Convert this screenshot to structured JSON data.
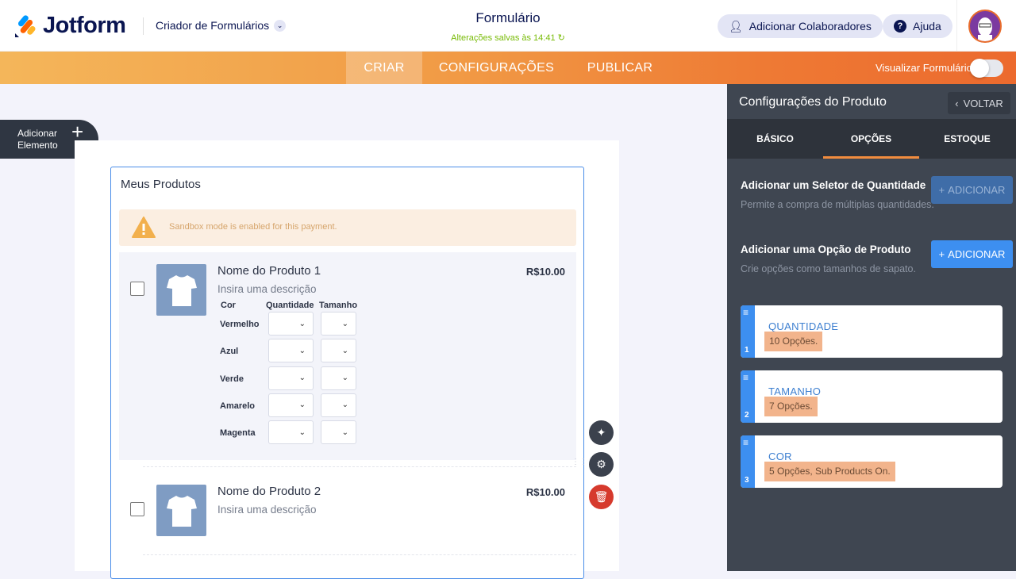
{
  "header": {
    "brand": "Jotform",
    "builder": "Criador de Formulários",
    "title": "Formulário",
    "saved": "Alterações salvas às 14:41",
    "collab": "Adicionar Colaboradores",
    "help": "Ajuda"
  },
  "nav": {
    "tabs": [
      "CRIAR",
      "CONFIGURAÇÕES",
      "PUBLICAR"
    ],
    "active": "CRIAR",
    "preview": "Visualizar Formulário",
    "preview_on": false
  },
  "canvas": {
    "add_element": [
      "Adicionar",
      "Elemento"
    ]
  },
  "widget": {
    "title": "Meus Produtos",
    "warning": "Sandbox mode is enabled for this payment.",
    "products": [
      {
        "name": "Nome do Produto 1",
        "description": "Insira uma descrição",
        "price": "R$10.00"
      },
      {
        "name": "Nome do Produto 2",
        "description": "Insira uma descrição",
        "price": "R$10.00"
      }
    ],
    "columns": [
      "Cor",
      "Quantidade",
      "Tamanho"
    ],
    "colors": [
      "Vermelho",
      "Azul",
      "Verde",
      "Amarelo",
      "Magenta"
    ]
  },
  "panel": {
    "title": "Configurações do Produto",
    "back": "VOLTAR",
    "tabs": [
      "BÁSICO",
      "OPÇÕES",
      "ESTOQUE"
    ],
    "active_tab": "OPÇÕES",
    "qty_title": "Adicionar um Seletor de Quantidade",
    "qty_desc": "Permite a compra de múltiplas quantidades.",
    "opt_title": "Adicionar uma Opção de Produto",
    "opt_desc": "Crie opções como tamanhos de sapato.",
    "add": "ADICIONAR",
    "options": [
      {
        "num": "1",
        "name": "QUANTIDADE",
        "info": "10 Opções."
      },
      {
        "num": "2",
        "name": "TAMANHO",
        "info": "7 Opções."
      },
      {
        "num": "3",
        "name": "COR",
        "info": "5 Opções, Sub Products On."
      }
    ]
  }
}
